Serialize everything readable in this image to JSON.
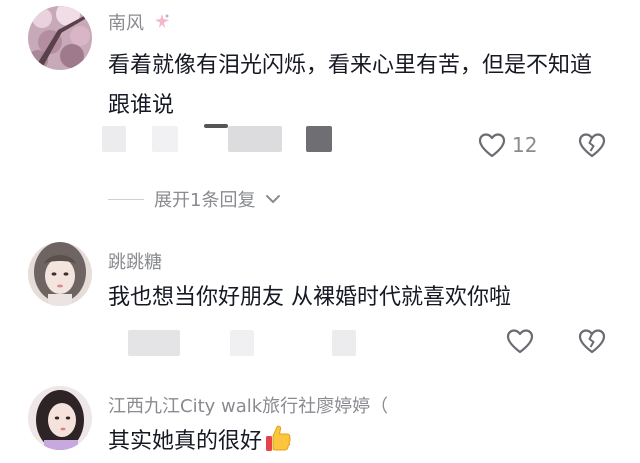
{
  "comments": [
    {
      "username": "南风",
      "username_badge": "fairy-sparkle-icon",
      "text": "看着就像有泪光闪烁，看来心里有苦，但是不知道跟谁说",
      "likes": "12",
      "replies_label": "展开1条回复"
    },
    {
      "username": "跳跳糖",
      "text": "我也想当你好朋友 从裸婚时代就喜欢你啦",
      "likes": ""
    },
    {
      "username": "江西九江City walk旅行社廖婷婷（",
      "text": "其实她真的很好",
      "text_emoji": "thumbs-up-emoji"
    }
  ],
  "colors": {
    "text_primary": "#161823",
    "text_secondary": "#8a8b91",
    "icon": "#6b6c72"
  }
}
